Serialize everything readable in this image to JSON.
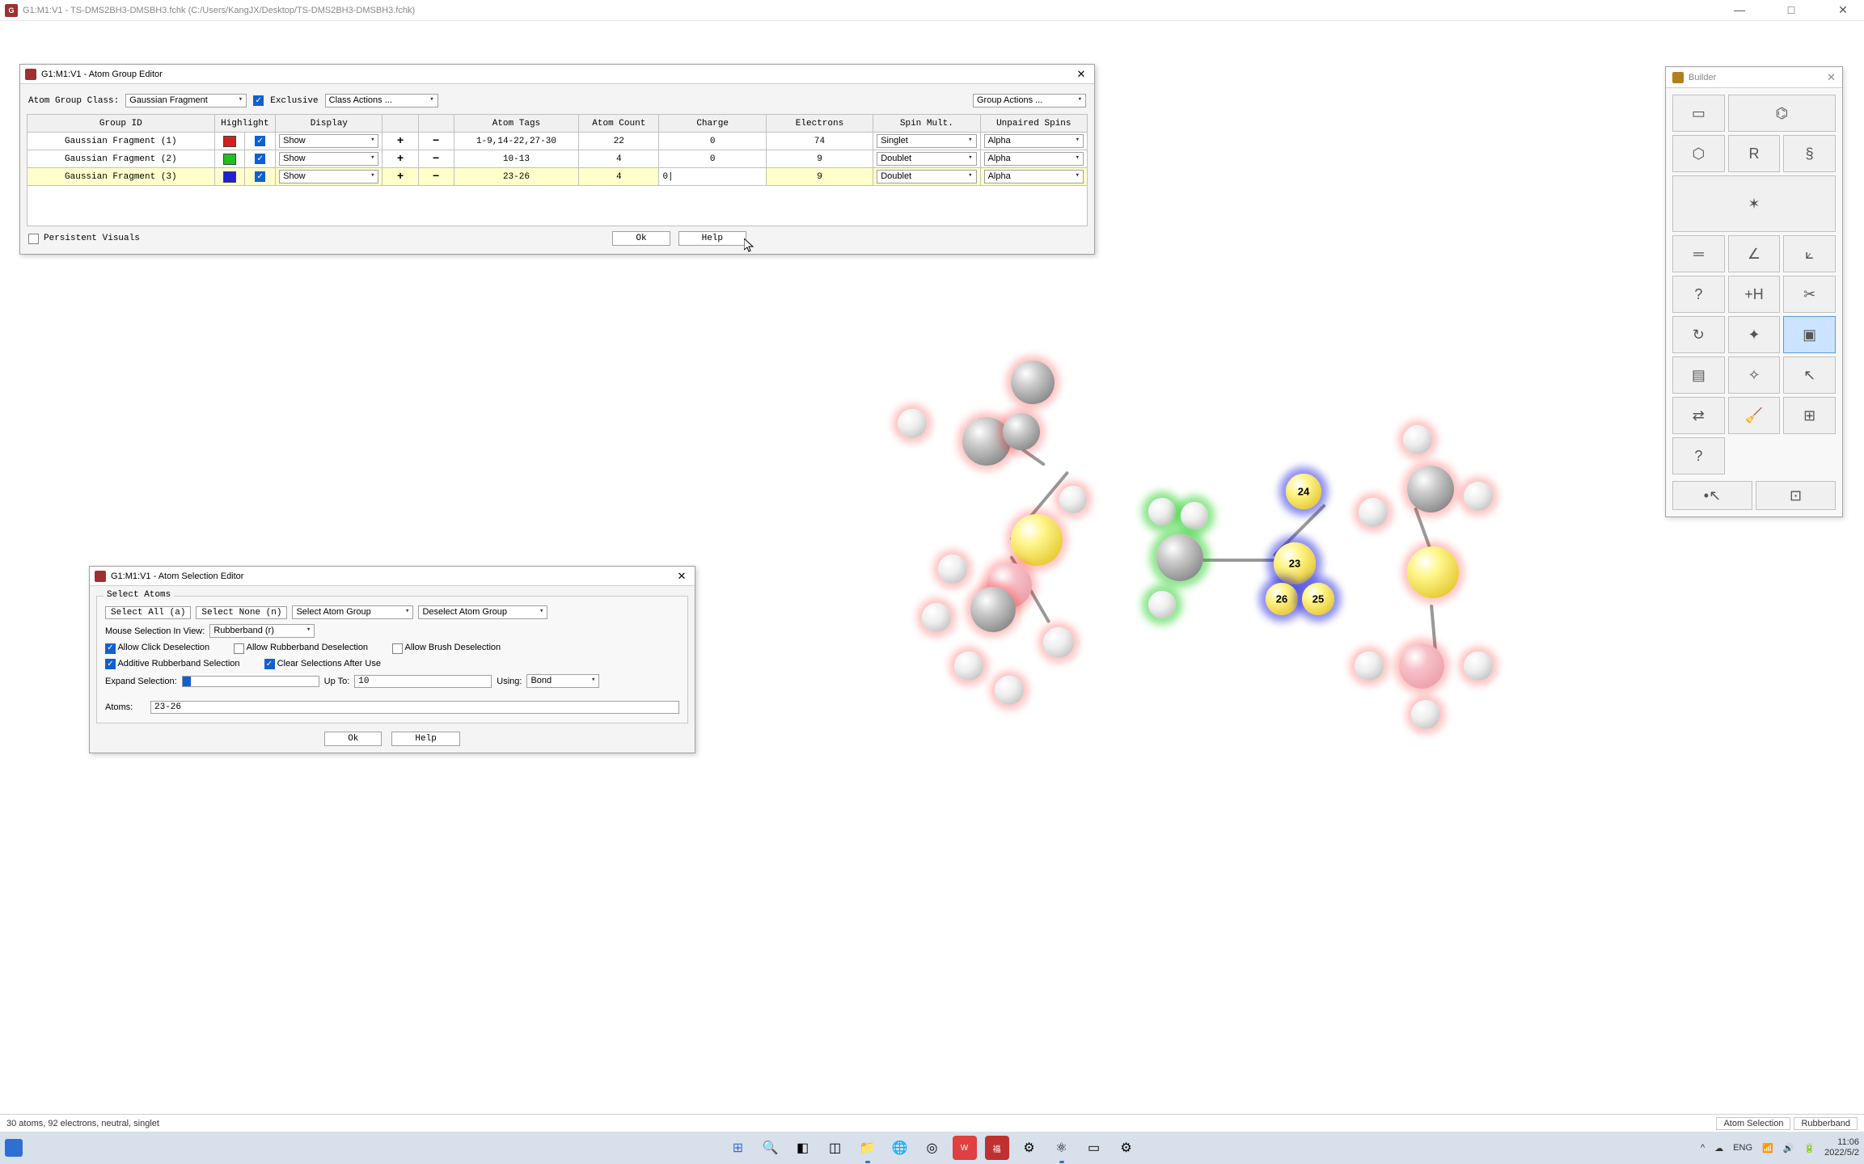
{
  "window": {
    "title": "G1:M1:V1 - TS-DMS2BH3-DMSBH3.fchk (C:/Users/KangJX/Desktop/TS-DMS2BH3-DMSBH3.fchk)"
  },
  "age": {
    "title": "G1:M1:V1 - Atom Group Editor",
    "class_label": "Atom Group Class:",
    "class_value": "Gaussian Fragment",
    "exclusive_label": "Exclusive",
    "class_actions": "Class Actions ...",
    "group_actions": "Group Actions ...",
    "headers": {
      "group_id": "Group ID",
      "highlight": "Highlight",
      "display": "Display",
      "atom_tags": "Atom Tags",
      "atom_count": "Atom Count",
      "charge": "Charge",
      "electrons": "Electrons",
      "spin_mult": "Spin Mult.",
      "unpaired_spins": "Unpaired Spins"
    },
    "rows": [
      {
        "id": "Gaussian Fragment (1)",
        "color": "#d02020",
        "display": "Show",
        "tags": "1-9,14-22,27-30",
        "count": "22",
        "charge": "0",
        "electrons": "74",
        "spin": "Singlet",
        "unpaired": "Alpha"
      },
      {
        "id": "Gaussian Fragment (2)",
        "color": "#20c020",
        "display": "Show",
        "tags": "10-13",
        "count": "4",
        "charge": "0",
        "electrons": "9",
        "spin": "Doublet",
        "unpaired": "Alpha"
      },
      {
        "id": "Gaussian Fragment (3)",
        "color": "#2020d0",
        "display": "Show",
        "tags": "23-26",
        "count": "4",
        "charge": "0|",
        "electrons": "9",
        "spin": "Doublet",
        "unpaired": "Alpha"
      }
    ],
    "persistent": "Persistent Visuals",
    "ok": "Ok",
    "help": "Help"
  },
  "ase": {
    "title": "G1:M1:V1 - Atom Selection Editor",
    "group_label": "Select Atoms",
    "select_all": "Select All (a)",
    "select_none": "Select None (n)",
    "select_group": "Select Atom Group",
    "deselect_group": "Deselect Atom Group",
    "mouse_label": "Mouse Selection In View:",
    "mouse_value": "Rubberband (r)",
    "allow_click": "Allow Click Deselection",
    "allow_rubber": "Allow Rubberband Deselection",
    "allow_brush": "Allow Brush Deselection",
    "additive": "Additive Rubberband Selection",
    "clear_after": "Clear Selections After Use",
    "expand_label": "Expand Selection:",
    "upto_label": "Up To:",
    "upto_value": "10",
    "using_label": "Using:",
    "using_value": "Bond",
    "atoms_label": "Atoms:",
    "atoms_value": "23-26",
    "ok": "Ok",
    "help": "Help"
  },
  "builder": {
    "title": "Builder"
  },
  "atom_labels": {
    "a23": "23",
    "a24": "24",
    "a25": "25",
    "a26": "26"
  },
  "status": {
    "left": "30 atoms, 92 electrons, neutral, singlet",
    "mode1": "Atom Selection",
    "mode2": "Rubberband"
  },
  "tray": {
    "lang": "ENG",
    "time": "11:06",
    "date": "2022/5/2"
  }
}
